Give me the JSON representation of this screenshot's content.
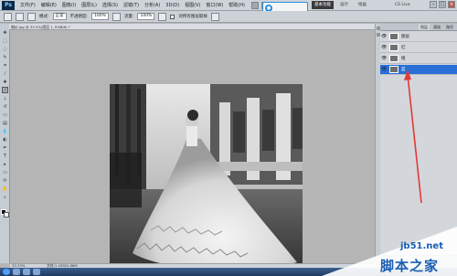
{
  "menubar": {
    "logo": "Ps",
    "items": [
      "文件(F)",
      "编辑(E)",
      "图像(I)",
      "图层(L)",
      "选择(S)",
      "滤镜(T)",
      "分析(A)",
      "3D(D)",
      "视图(V)",
      "窗口(W)",
      "帮助(H)"
    ],
    "workspace": "基本功能",
    "links": [
      "设计",
      "绘画"
    ],
    "cslive": "CS Live"
  },
  "search": {
    "text": ""
  },
  "options": {
    "mode_label": "模式:",
    "mode_value": "正常",
    "opacity_label": "不透明度:",
    "opacity_value": "100%",
    "flow_label": "流量:",
    "flow_value": "100%",
    "sample_label": "对所有图层取样"
  },
  "document": {
    "tab": "婚纱.jpg @ 33.3%(图层 1, RGB/8) *",
    "zoom": "33.33%",
    "doc_size": "文档:1.43M/2.86M"
  },
  "layers": {
    "tabs": [
      "图层",
      "通道",
      "路径"
    ],
    "rows": [
      {
        "name": "图层",
        "selected": false
      },
      {
        "name": "红",
        "selected": false
      },
      {
        "name": "橙",
        "selected": false
      },
      {
        "name": "蓝",
        "selected": true
      }
    ]
  },
  "watermark": {
    "site": "jb51.net",
    "cn": "脚本之家"
  },
  "colors": {
    "accent": "#2a6fd6",
    "arrow": "#e53935",
    "watermark": "#1a5fb4"
  }
}
